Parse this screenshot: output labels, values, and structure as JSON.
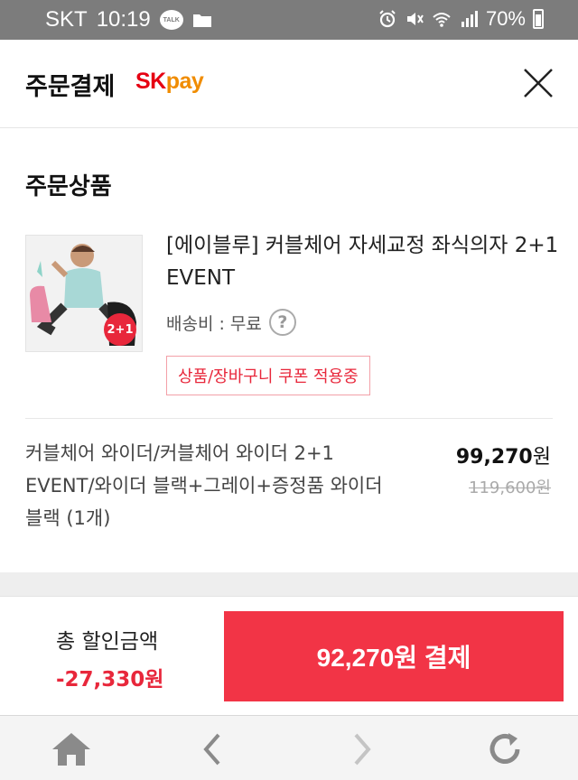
{
  "status_bar": {
    "carrier": "SKT",
    "time": "10:19",
    "talk_badge": "TALK",
    "battery": "70%"
  },
  "header": {
    "title": "주문결제",
    "brand_sk": "SK",
    "brand_pay": "pay"
  },
  "order": {
    "section_title": "주문상품",
    "product_name": "[에이블루] 커블체어 자세교정 좌식의자 2+1 EVENT",
    "image_badge": "2+1",
    "shipping_label": "배송비 : 무료",
    "help_symbol": "?",
    "coupon_badge": "상품/장바구니 쿠폰 적용중",
    "option_text": "커블체어 와이더/커블체어 와이더 2+1 EVENT/와이더 블랙+그레이+증정품 와이더 블랙 (1개)",
    "price_value": "99,270",
    "price_unit": "원",
    "original_price": "119,600원"
  },
  "footer": {
    "discount_label": "총 할인금액",
    "discount_value": "-27,330원",
    "pay_button": "92,270원 결제"
  },
  "colors": {
    "accent_red": "#f23446",
    "sk_red": "#e60012",
    "pay_orange": "#f08c00",
    "status_bar": "#7c7c7c"
  },
  "bottom_nav": [
    "home-icon",
    "back-icon",
    "forward-icon",
    "refresh-icon"
  ]
}
